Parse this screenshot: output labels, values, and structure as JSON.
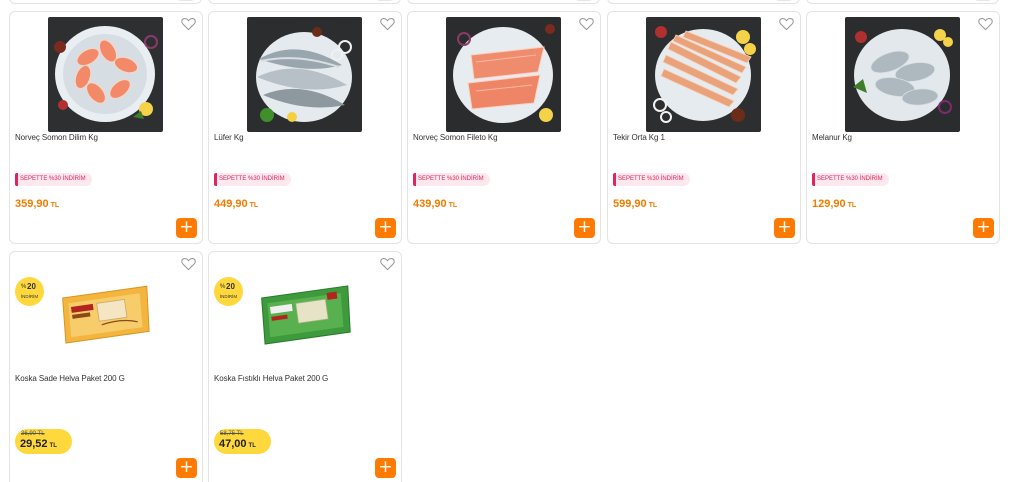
{
  "colors": {
    "accent": "#ff7a00",
    "price": "#f07c00",
    "promo_text": "#e0245e",
    "promo_bg": "#fde8ee",
    "discount_badge": "#ffd83d"
  },
  "products": [
    {
      "name": "Norveç Somon Dilim Kg",
      "promo": "SEPETTE %30 İNDİRİM",
      "price": "359,90",
      "currency": "TL",
      "image": "salmon-steaks-on-ice",
      "add_icon": "+"
    },
    {
      "name": "Lüfer Kg",
      "promo": "SEPETTE %30 İNDİRİM",
      "price": "449,90",
      "currency": "TL",
      "image": "bluefish-on-ice",
      "add_icon": "+"
    },
    {
      "name": "Norveç Somon Fileto Kg",
      "promo": "SEPETTE %30 İNDİRİM",
      "price": "439,90",
      "currency": "TL",
      "image": "salmon-fillet-on-ice",
      "add_icon": "+"
    },
    {
      "name": "Tekir Orta Kg 1",
      "promo": "SEPETTE %30 İNDİRİM",
      "price": "599,90",
      "currency": "TL",
      "image": "red-mullet-on-ice",
      "add_icon": "+"
    },
    {
      "name": "Melanur Kg",
      "promo": "SEPETTE %30 İNDİRİM",
      "price": "129,90",
      "currency": "TL",
      "image": "saddled-bream-on-ice",
      "add_icon": "+"
    },
    {
      "name": "Koska Sade Helva Paket 200 G",
      "badge": {
        "prefix": "%",
        "value": "20",
        "label": "İNDİRİM"
      },
      "old_price": "36,90 TL",
      "price": "29,52",
      "currency": "TL",
      "image": "koska-plain-halva-package",
      "add_icon": "+"
    },
    {
      "name": "Koska Fıstıklı Helva Paket 200 G",
      "badge": {
        "prefix": "%",
        "value": "20",
        "label": "İNDİRİM"
      },
      "old_price": "58,75 TL",
      "price": "47,00",
      "currency": "TL",
      "image": "koska-pistachio-halva-package",
      "add_icon": "+"
    }
  ]
}
